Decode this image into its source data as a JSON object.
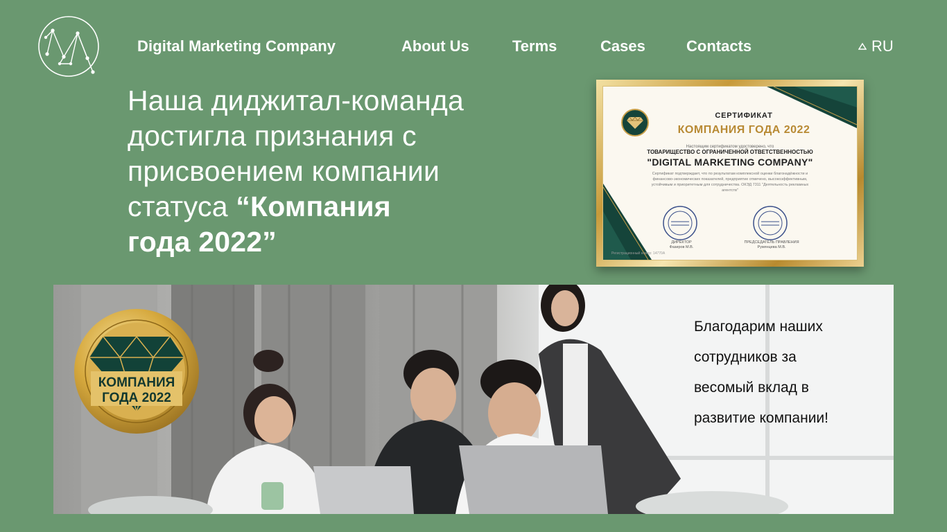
{
  "header": {
    "logo_icon": "constellation-logo-icon",
    "brand": "Digital Marketing Company",
    "nav": [
      {
        "label": "About Us"
      },
      {
        "label": "Terms"
      },
      {
        "label": "Cases"
      },
      {
        "label": "Contacts"
      }
    ],
    "language": {
      "icon": "triangle-up-icon",
      "code": "RU"
    }
  },
  "hero": {
    "lines": [
      "Наша диджитал-команда",
      "достигла признания с",
      "присвоением компании",
      "статуса "
    ],
    "emphasis_1": "“Компания",
    "emphasis_2": "года  2022”"
  },
  "certificate": {
    "heading": "СЕРТИФИКАТ",
    "title": "КОМПАНИЯ ГОДА 2022",
    "intro": "Настоящим сертификатом удостоверено, что",
    "org_type": "ТОВАРИЩЕСТВО С ОГРАНИЧЕННОЙ ОТВЕТСТВЕННОСТЬЮ",
    "company": "\"DIGITAL MARKETING COMPANY\"",
    "body": "Сертификат подтверждает, что по результатам комплексной оценки благонадёжности и финансово-экономических показателей, предприятие отмечено, высокоэффективным, устойчивым и приоритетным для сотрудничества. ОКЭД 7311 \"Деятельность рекламных агентств\"",
    "signer_1_role": "ДИРЕКТОР",
    "signer_1_name": "Фазиров М.В.",
    "signer_2_role": "ПРЕДСЕДАТЕЛЬ ПРАВЛЕНИЯ",
    "signer_2_name": "Румянцева М.В.",
    "reg_number": "Регистрационный номер: 14770А"
  },
  "medal": {
    "title_line_1": "КОМПАНИЯ",
    "title_line_2": "ГОДА 2022"
  },
  "photo_caption": {
    "lines": [
      "Благодарим наших",
      "сотрудников за",
      "весомый вклад в",
      "развитие компании!"
    ]
  },
  "colors": {
    "background": "#6a9870",
    "text": "#ffffff",
    "gold": "#c9a04a",
    "emerald": "#15443a"
  }
}
